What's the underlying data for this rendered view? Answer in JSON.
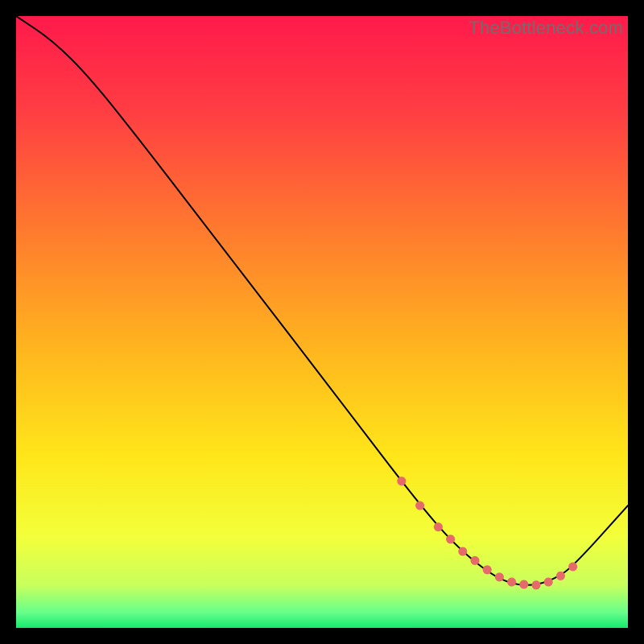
{
  "watermark": "TheBottleneck.com",
  "chart_data": {
    "type": "line",
    "title": "",
    "xlabel": "",
    "ylabel": "",
    "xlim": [
      0,
      100
    ],
    "ylim": [
      0,
      100
    ],
    "series": [
      {
        "name": "curve",
        "x": [
          0,
          6,
          12,
          20,
          30,
          40,
          50,
          58,
          63,
          67,
          70,
          73,
          76,
          79,
          82,
          85,
          88,
          91,
          100
        ],
        "y": [
          100,
          96,
          90,
          80,
          67,
          54,
          41,
          30.5,
          24,
          19,
          15.5,
          12.5,
          10,
          8,
          7,
          7,
          8,
          10,
          20
        ]
      }
    ],
    "markers": {
      "name": "highlight-points",
      "x": [
        63,
        66,
        69,
        71,
        73,
        75,
        77,
        79,
        81,
        83,
        85,
        87,
        89,
        91
      ],
      "y": [
        24,
        20,
        16.5,
        14.5,
        12.5,
        11,
        9.5,
        8.3,
        7.5,
        7.1,
        7.0,
        7.5,
        8.5,
        10
      ]
    },
    "gradient_stops": [
      {
        "offset": 0.0,
        "color": "#ff1a4b"
      },
      {
        "offset": 0.15,
        "color": "#ff3c43"
      },
      {
        "offset": 0.35,
        "color": "#ff7a2e"
      },
      {
        "offset": 0.55,
        "color": "#ffb71e"
      },
      {
        "offset": 0.72,
        "color": "#ffe61a"
      },
      {
        "offset": 0.85,
        "color": "#f3ff3a"
      },
      {
        "offset": 0.93,
        "color": "#c9ff5d"
      },
      {
        "offset": 0.975,
        "color": "#66ff8a"
      },
      {
        "offset": 1.0,
        "color": "#15e86f"
      }
    ]
  }
}
